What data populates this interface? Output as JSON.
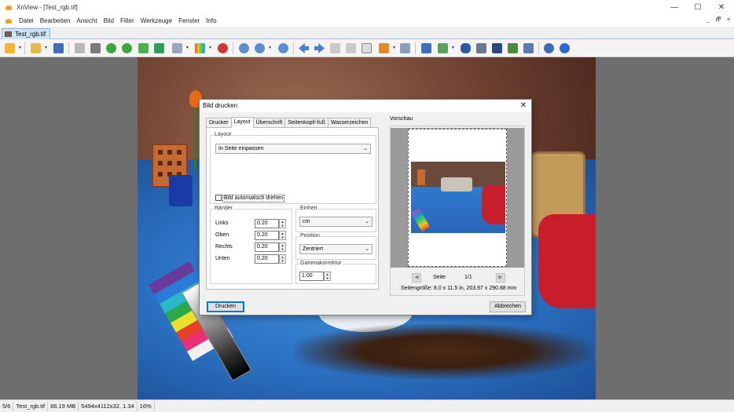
{
  "window": {
    "title": "XnView - [Test_rgb.tif]",
    "minimize": "—",
    "maximize": "☐",
    "close": "✕"
  },
  "menu": [
    "Datei",
    "Bearbeiten",
    "Ansicht",
    "Bild",
    "Filter",
    "Werkzeuge",
    "Fenster",
    "Info"
  ],
  "mdi_controls": [
    "_",
    "🗗",
    "✕"
  ],
  "doc_tab": "Test_rgb.tif",
  "toolbar_icons": [
    "browser-icon",
    "open-folder-icon",
    "save-icon",
    "back-icon",
    "crop-icon",
    "rotate-left-icon",
    "rotate-right-icon",
    "export-icon",
    "convert-icon",
    "slideshow-icon",
    "color-icon",
    "effects-icon",
    "zoom-in-icon",
    "zoom-fit-icon",
    "zoom-out-icon",
    "previous-icon",
    "next-icon",
    "first-icon",
    "last-icon",
    "window-icon",
    "screen-icon",
    "capture-icon",
    "fullscreen-icon",
    "compare-icon",
    "binoculars-icon",
    "print-icon",
    "scanner-icon",
    "wallpaper-icon",
    "properties-icon",
    "settings-icon",
    "info-icon"
  ],
  "statusbar": [
    "5/6",
    "Test_rgb.tif",
    "86.19 MB",
    "5494x4112x32, 1.34",
    "16%"
  ],
  "dialog": {
    "title": "Bild drucken",
    "tabs": [
      "Drucker",
      "Layout",
      "Überschrift",
      "Seitenkopf/-fuß",
      "Wasserzeichen"
    ],
    "active_tab": "Layout",
    "layout_group": "Layout",
    "layout_select": "In Seite einpassen",
    "auto_rotate_label": "Bild automatisch drehen",
    "auto_rotate_checked": false,
    "margins_group": "Ränder",
    "margins": [
      {
        "label": "Links",
        "value": "0.20"
      },
      {
        "label": "Oben",
        "value": "0.20"
      },
      {
        "label": "Rechts",
        "value": "0.20"
      },
      {
        "label": "Unten",
        "value": "0.20"
      }
    ],
    "unit_group": "Einheit",
    "unit_select": "cm",
    "position_group": "Position",
    "position_select": "Zentriert",
    "gamma_group": "Gammakorrektur",
    "gamma_value": "1.00",
    "print_button": "Drucken",
    "cancel_button": "Abbrechen",
    "preview_label": "Vorschau",
    "page_label": "Seite",
    "page_count": "1/1",
    "page_size": "Seitengröße: 8.0 x 11.5 in, 203.97 x 290.88 mm"
  }
}
